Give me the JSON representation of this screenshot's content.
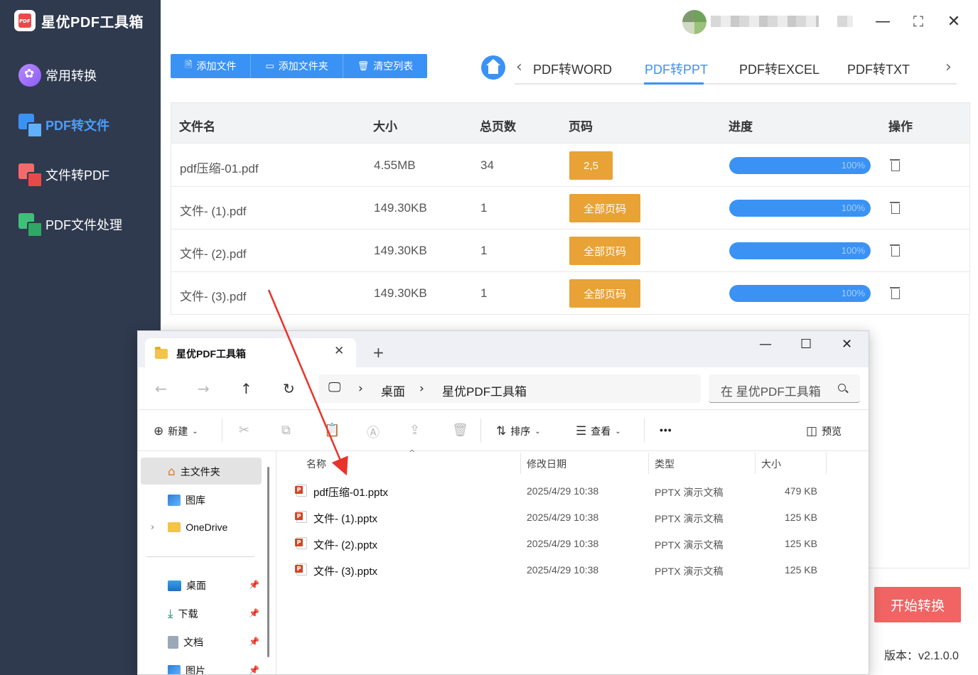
{
  "app": {
    "title": "星优PDF工具箱",
    "version": "版本：v2.1.0.0",
    "start_button": "开始转换"
  },
  "sidebar": {
    "items": [
      {
        "label": "常用转换",
        "icon": "grid-icon"
      },
      {
        "label": "PDF转文件",
        "icon": "pdf-to-file-icon"
      },
      {
        "label": "文件转PDF",
        "icon": "file-to-pdf-icon"
      },
      {
        "label": "PDF文件处理",
        "icon": "pdf-process-icon"
      }
    ]
  },
  "toolbar": {
    "add_file": "添加文件",
    "add_folder": "添加文件夹",
    "clear_list": "清空列表"
  },
  "tabs": {
    "items": [
      "PDF转WORD",
      "PDF转PPT",
      "PDF转EXCEL",
      "PDF转TXT"
    ],
    "active": "PDF转PPT"
  },
  "table": {
    "headers": {
      "name": "文件名",
      "size": "大小",
      "pages": "总页数",
      "range": "页码",
      "progress": "进度",
      "actions": "操作"
    },
    "rows": [
      {
        "name": "pdf压缩-01.pdf",
        "size": "4.55MB",
        "pages": "34",
        "range": "2,5",
        "progress": "100%",
        "progress_value": 100
      },
      {
        "name": "文件- (1).pdf",
        "size": "149.30KB",
        "pages": "1",
        "range": "全部页码",
        "progress": "100%",
        "progress_value": 100
      },
      {
        "name": "文件- (2).pdf",
        "size": "149.30KB",
        "pages": "1",
        "range": "全部页码",
        "progress": "100%",
        "progress_value": 100
      },
      {
        "name": "文件- (3).pdf",
        "size": "149.30KB",
        "pages": "1",
        "range": "全部页码",
        "progress": "100%",
        "progress_value": 100
      }
    ]
  },
  "explorer": {
    "tab_title": "星优PDF工具箱",
    "breadcrumb": [
      "桌面",
      "星优PDF工具箱"
    ],
    "search_placeholder": "在 星优PDF工具箱",
    "commands": {
      "new": "新建",
      "sort": "排序",
      "view": "查看",
      "more": "•••",
      "preview": "预览"
    },
    "nav": {
      "home": "主文件夹",
      "gallery": "图库",
      "onedrive": "OneDrive",
      "desktop": "桌面",
      "downloads": "下载",
      "documents": "文档",
      "pictures": "图片"
    },
    "columns": {
      "name": "名称",
      "modified": "修改日期",
      "type": "类型",
      "size": "大小"
    },
    "files": [
      {
        "name": "pdf压缩-01.pptx",
        "modified": "2025/4/29 10:38",
        "type": "PPTX 演示文稿",
        "size": "479 KB"
      },
      {
        "name": "文件- (1).pptx",
        "modified": "2025/4/29 10:38",
        "type": "PPTX 演示文稿",
        "size": "125 KB"
      },
      {
        "name": "文件- (2).pptx",
        "modified": "2025/4/29 10:38",
        "type": "PPTX 演示文稿",
        "size": "125 KB"
      },
      {
        "name": "文件- (3).pptx",
        "modified": "2025/4/29 10:38",
        "type": "PPTX 演示文稿",
        "size": "125 KB"
      }
    ]
  },
  "colors": {
    "sidebar_bg": "#2f3a4f",
    "accent_blue": "#3a92f5",
    "page_button": "#e8a235",
    "start_button": "#f06464",
    "annotation_arrow": "#e8332a"
  }
}
